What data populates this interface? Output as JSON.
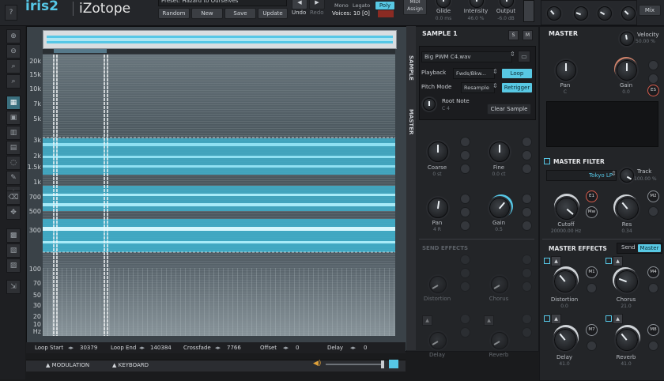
{
  "topbar": {
    "logo": "iris2",
    "brand": "iZotope",
    "preset_name": "Preset: Hazard to Ourselves",
    "preset_buttons": [
      "Random",
      "New",
      "Save",
      "Update"
    ],
    "undo": "Undo",
    "redo": "Redo",
    "voice_modes": [
      "Mono",
      "Legato",
      "Poly"
    ],
    "voices_label": "Voices: 10 [0]",
    "midi_assign": "MIDI Assign",
    "glide": {
      "label": "Glide",
      "value": "0.0 ms"
    },
    "intensity": {
      "label": "Intensity",
      "value": "46.0 %"
    },
    "output": {
      "label": "Output",
      "value": "-6.0 dB"
    },
    "mix": "Mix"
  },
  "spectrogram": {
    "freq_labels": [
      "20k",
      "15k",
      "10k",
      "7k",
      "5k",
      "3k",
      "2k",
      "1.5k",
      "1k",
      "700",
      "500",
      "300",
      "100",
      "70",
      "50",
      "30",
      "20",
      "10"
    ],
    "hz": "Hz",
    "loop_start": {
      "label": "Loop Start",
      "value": "30379"
    },
    "loop_end": {
      "label": "Loop End",
      "value": "140384"
    },
    "crossfade": {
      "label": "Crossfade",
      "value": "7766"
    },
    "offset": {
      "label": "Offset",
      "value": "0"
    },
    "delay": {
      "label": "Delay",
      "value": "0"
    }
  },
  "bottom_tabs": [
    "MODULATION",
    "KEYBOARD"
  ],
  "sample": {
    "title": "SAMPLE 1",
    "solo": "S",
    "mute": "M",
    "file": "Big PWM C4.wav",
    "playback_label": "Playback",
    "playback_value": "Fwds/Bkw...",
    "loop": "Loop",
    "pitch_mode_label": "Pitch Mode",
    "pitch_mode_value": "Resample",
    "retrigger": "Retrigger",
    "root_note_label": "Root Note",
    "root_note_value": "C 4",
    "clear_sample": "Clear Sample",
    "side_tabs": [
      "SAMPLE",
      "MASTER"
    ],
    "coarse": {
      "label": "Coarse",
      "value": "0 st"
    },
    "fine": {
      "label": "Fine",
      "value": "0.0 ct"
    },
    "pan": {
      "label": "Pan",
      "value": "4 R"
    },
    "gain": {
      "label": "Gain",
      "value": "0.5"
    },
    "send_effects": "SEND EFFECTS",
    "sends": [
      {
        "label": "Distortion"
      },
      {
        "label": "Chorus"
      },
      {
        "label": "Delay"
      },
      {
        "label": "Reverb"
      }
    ]
  },
  "master": {
    "title": "MASTER",
    "velocity": {
      "label": "Velocity",
      "value": "50.00 %"
    },
    "pan": {
      "label": "Pan",
      "value": "C"
    },
    "gain": {
      "label": "Gain",
      "value": "0.0"
    },
    "es_badge": "ES",
    "filter_title": "MASTER FILTER",
    "filter_type": "Tokyo LP",
    "track": {
      "label": "Track",
      "value": "100.00 %"
    },
    "cutoff": {
      "label": "Cutoff",
      "value": "20000.00 Hz"
    },
    "res": {
      "label": "Res",
      "value": "0.34"
    },
    "badges_filter": [
      "E1",
      "M2",
      "Mw"
    ],
    "effects_title": "MASTER EFFECTS",
    "send_tab": "Send",
    "master_tab": "Master",
    "effects": [
      {
        "label": "Distortion",
        "value": "0.0",
        "badge": "M1"
      },
      {
        "label": "Chorus",
        "value": "21.0",
        "badge": "M4"
      },
      {
        "label": "Delay",
        "value": "41.0",
        "badge": "M7"
      },
      {
        "label": "Reverb",
        "value": "41.0",
        "badge": "M8"
      }
    ]
  },
  "colors": {
    "accent": "#56c7e6",
    "panel": "#26282c",
    "background": "#1a1b1d"
  },
  "icons": [
    "help-icon",
    "zoom-in-icon",
    "zoom-out-icon",
    "zoom-fit-icon",
    "zoom-reset-icon",
    "view-mode-icon",
    "rect-select-icon",
    "time-select-icon",
    "freq-select-icon",
    "lasso-icon",
    "brush-icon",
    "magic-wand-icon",
    "eraser-icon",
    "transform-icon",
    "grid-icon",
    "filter-icon",
    "pattern-icon",
    "export-icon",
    "folder-icon",
    "speaker-icon"
  ]
}
